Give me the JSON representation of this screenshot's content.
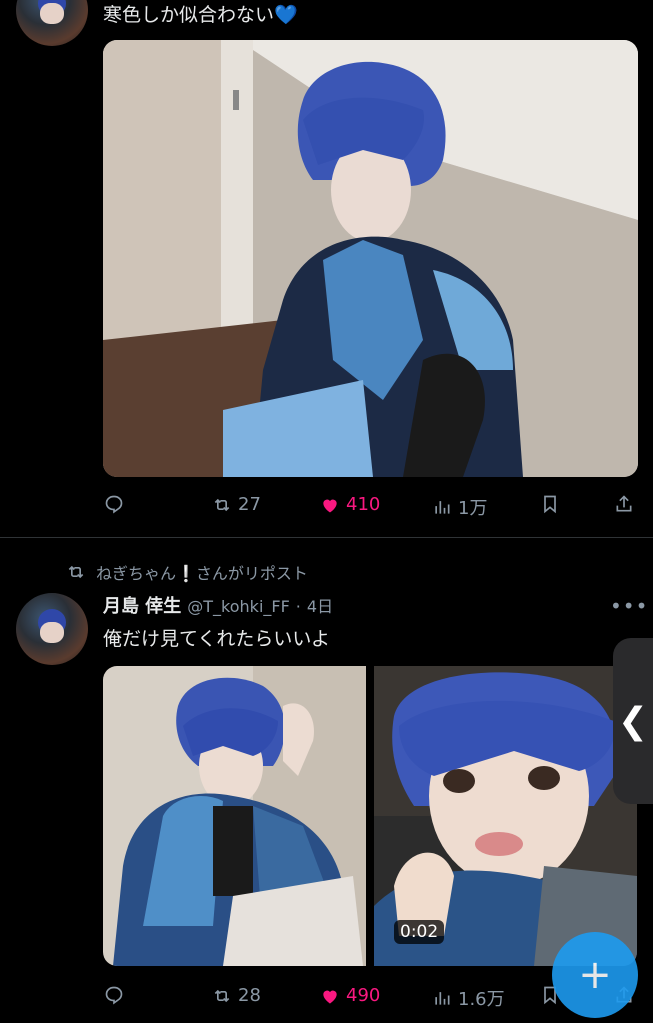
{
  "tweet1": {
    "text": "寒色しか似合わない💙",
    "actions": {
      "retweets": "27",
      "likes": "410",
      "views": "1万"
    }
  },
  "tweet2": {
    "repost_label": "ねぎちゃん❕さんがリポスト",
    "author_name": "月島 倖生",
    "handle": "@T_kohki_FF",
    "time": "4日",
    "text": "俺だけ見てくれたらいいよ",
    "video_duration": "0:02",
    "actions": {
      "retweets": "28",
      "likes": "490",
      "views": "1.6万"
    }
  },
  "fab_label": "+",
  "side_tab_label": "❮",
  "colors": {
    "like": "#f91880",
    "icon": "#8b98a5",
    "accent": "#1d9bf0"
  }
}
